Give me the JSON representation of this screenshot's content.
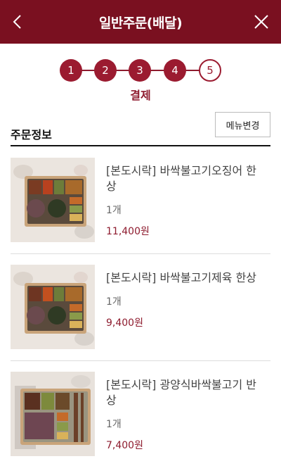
{
  "header": {
    "title": "일반주문(배달)"
  },
  "stepper": {
    "steps": [
      "1",
      "2",
      "3",
      "4",
      "5"
    ],
    "current_step": 5,
    "current_label": "결제"
  },
  "order_section": {
    "title": "주문정보",
    "change_menu_button": "메뉴변경"
  },
  "items": [
    {
      "name": "[본도시락] 바싹불고기오징어 한상",
      "qty": "1개",
      "price": "11,400원"
    },
    {
      "name": "[본도시락] 바싹불고기제육 한상",
      "qty": "1개",
      "price": "9,400원"
    },
    {
      "name": "[본도시락] 광양식바싹불고기 반상",
      "qty": "1개",
      "price": "7,400원"
    }
  ],
  "colors": {
    "brand": "#7a1020",
    "accent": "#9b1b30"
  }
}
